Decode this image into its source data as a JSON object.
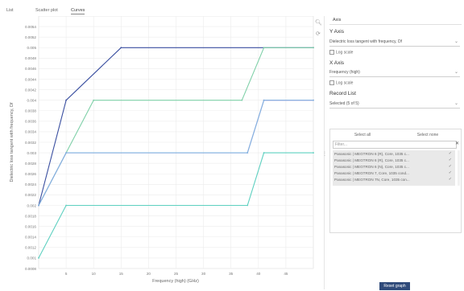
{
  "tabs": [
    {
      "label": "List"
    },
    {
      "label": "Scatter plot"
    },
    {
      "label": "Curves"
    }
  ],
  "chart_data": {
    "type": "line",
    "xlabel": "Frequency (high) (GHz)",
    "ylabel": "Dielectric loss tangent with frequency, Df",
    "xlim": [
      0,
      50
    ],
    "ylim": [
      0.0008,
      0.0056
    ],
    "xticks": [
      5,
      10,
      15,
      20,
      25,
      30,
      35,
      40,
      45
    ],
    "yticks": [
      0.0008,
      0.001,
      0.0012,
      0.0014,
      0.0016,
      0.0018,
      0.002,
      0.0022,
      0.0024,
      0.0026,
      0.0028,
      0.003,
      0.0032,
      0.0034,
      0.0036,
      0.0038,
      0.004,
      0.0042,
      0.0044,
      0.0046,
      0.0048,
      0.005,
      0.0052,
      0.0054
    ],
    "ytick_labels": [
      "0.0008",
      "0.001",
      "0.0012",
      "0.0014",
      "0.0016",
      "0.0018",
      "0.002",
      "0.0022",
      "0.0024",
      "0.0026",
      "0.0028",
      "0.003",
      "0.0032",
      "0.0034",
      "0.0036",
      "0.0038",
      "0.004",
      "0.0042",
      "0.0044",
      "0.0046",
      "0.0048",
      "0.005",
      "0.0052",
      "0.0054"
    ],
    "grid": true,
    "series": [
      {
        "color": "#3a4fa0",
        "x": [
          0,
          5,
          15,
          50
        ],
        "y": [
          0.002,
          0.004,
          0.005,
          0.005
        ]
      },
      {
        "color": "#7fd0a8",
        "x": [
          0,
          10,
          37,
          41,
          50
        ],
        "y": [
          0.002,
          0.004,
          0.004,
          0.005,
          0.005
        ]
      },
      {
        "color": "#c46ad8",
        "x": [
          0,
          5,
          38,
          41,
          50
        ],
        "y": [
          0.002,
          0.003,
          0.003,
          0.004,
          0.004
        ]
      },
      {
        "color": "#7fb8e0",
        "x": [
          0,
          5,
          38,
          41,
          50
        ],
        "y": [
          0.002,
          0.003,
          0.003,
          0.004,
          0.004
        ]
      },
      {
        "color": "#5ed0c0",
        "x": [
          0,
          5,
          38,
          41,
          50
        ],
        "y": [
          0.001,
          0.002,
          0.002,
          0.003,
          0.003
        ]
      }
    ]
  },
  "panel": {
    "tab": "Axis",
    "y_axis_title": "Y Axis",
    "y_axis_value": "Dielectric loss tangent with frequency, Df",
    "y_log": "Log scale",
    "x_axis_title": "X Axis",
    "x_axis_value": "Frequency (high)",
    "x_log": "Log scale",
    "record_title": "Record List",
    "record_select": "Selected (5 of 5)",
    "select_all": "Select all",
    "select_none": "Select none",
    "filter_placeholder": "Filter...",
    "records": [
      "Panasonic | MEGTRON 6 (R), Core, 1035 c...",
      "Panasonic | MEGTRON 6 (R), Core, 1035 c...",
      "Panasonic | MEGTRON 6 (N), Core, 1035 c...",
      "Panasonic | MEGTRON 7, Core, 1035 cond...",
      "Panasonic | MEGTRON 7N, Core, 1035 con..."
    ],
    "reset": "Reset graph"
  }
}
